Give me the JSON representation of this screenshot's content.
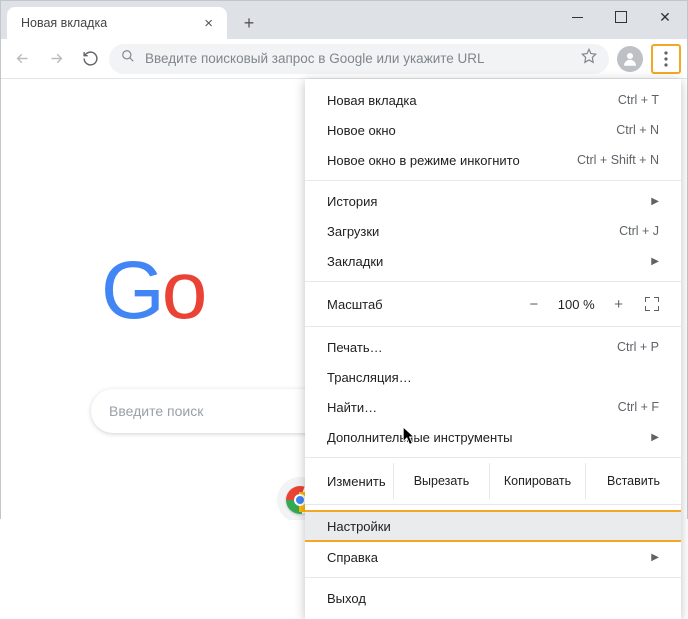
{
  "tab": {
    "title": "Новая вкладка"
  },
  "omnibox": {
    "placeholder": "Введите поисковый запрос в Google или укажите URL"
  },
  "logo_letters": [
    "G",
    "o"
  ],
  "searchbar_placeholder": "Введите поиск",
  "menu": {
    "new_tab": {
      "label": "Новая вкладка",
      "shortcut": "Ctrl + T"
    },
    "new_window": {
      "label": "Новое окно",
      "shortcut": "Ctrl + N"
    },
    "incognito": {
      "label": "Новое окно в режиме инкогнито",
      "shortcut": "Ctrl + Shift + N"
    },
    "history": {
      "label": "История"
    },
    "downloads": {
      "label": "Загрузки",
      "shortcut": "Ctrl + J"
    },
    "bookmarks": {
      "label": "Закладки"
    },
    "zoom": {
      "label": "Масштаб",
      "value": "100 %"
    },
    "print": {
      "label": "Печать…",
      "shortcut": "Ctrl + P"
    },
    "cast": {
      "label": "Трансляция…"
    },
    "find": {
      "label": "Найти…",
      "shortcut": "Ctrl + F"
    },
    "more_tools": {
      "label": "Дополнительные инструменты"
    },
    "edit": {
      "label": "Изменить",
      "cut": "Вырезать",
      "copy": "Копировать",
      "paste": "Вставить"
    },
    "settings": {
      "label": "Настройки"
    },
    "help": {
      "label": "Справка"
    },
    "exit": {
      "label": "Выход"
    }
  }
}
